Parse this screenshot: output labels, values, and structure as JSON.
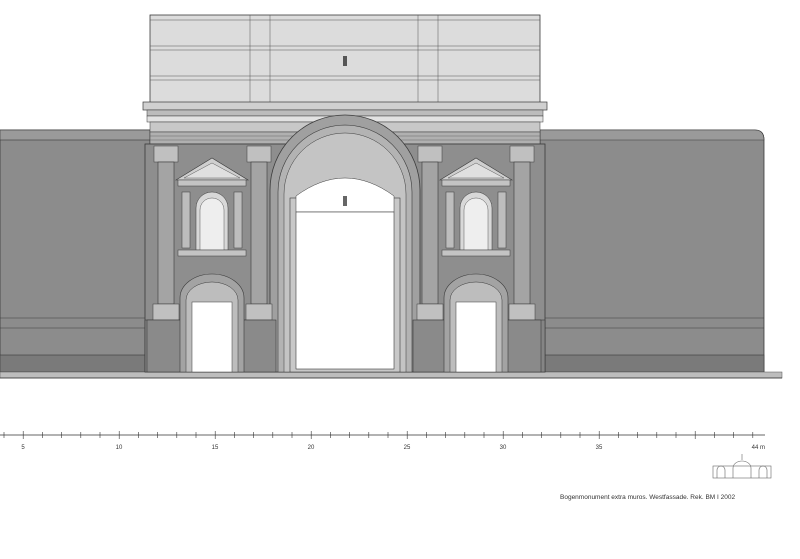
{
  "scale_bar": {
    "labels": [
      "5",
      "10",
      "15",
      "20",
      "25",
      "30",
      "35",
      "44 m"
    ]
  },
  "caption": "Bogenmonument extra muros. Westfassade. Rek. BM I 2002",
  "colors": {
    "wall": "#8a8a8a",
    "wall_dark": "#6e6e6e",
    "stone": "#b9b9b9",
    "attic": "#d8d8d8",
    "cornice": "#cfcfcf",
    "column": "#9f9f9f",
    "opening": "#ffffff",
    "line": "#3a3a3a"
  }
}
